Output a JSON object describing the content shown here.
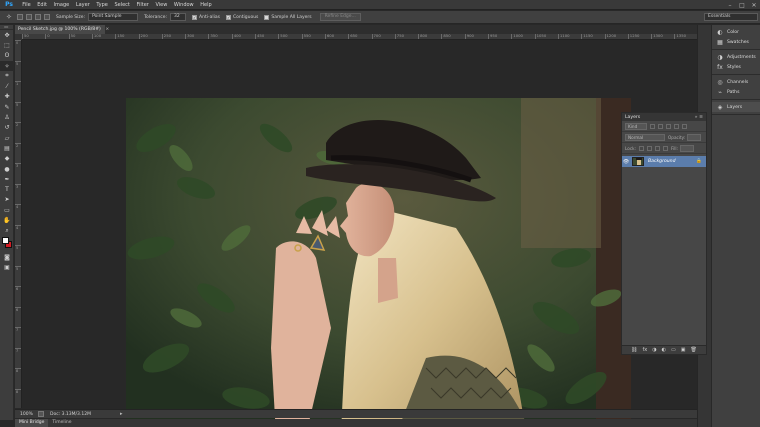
{
  "app": {
    "logo": "Ps"
  },
  "menu": [
    "File",
    "Edit",
    "Image",
    "Layer",
    "Type",
    "Select",
    "Filter",
    "View",
    "Window",
    "Help"
  ],
  "window_controls": [
    "–",
    "□",
    "✕"
  ],
  "options": {
    "tool_icon": "magic-wand-icon",
    "sample_size_label": "Sample Size:",
    "sample_size_value": "Point Sample",
    "tolerance_label": "Tolerance:",
    "tolerance_value": "32",
    "anti_alias": "Anti-alias",
    "contiguous": "Contiguous",
    "sample_all_layers": "Sample All Layers",
    "refine_edge": "Refine Edge...",
    "workspace": "Essentials"
  },
  "document": {
    "tab_title": "Pencil Sketch.jpg @ 100% (RGB/8#)",
    "close_glyph": "×"
  },
  "ruler_h": [
    "50",
    "0",
    "50",
    "100",
    "150",
    "200",
    "250",
    "300",
    "350",
    "400",
    "450",
    "500",
    "550",
    "600",
    "650",
    "700",
    "750",
    "800",
    "850",
    "900",
    "950",
    "1000",
    "1050",
    "1100",
    "1150",
    "1200",
    "1250",
    "1300",
    "1350",
    "1400"
  ],
  "ruler_v": [
    "0",
    "5",
    "1",
    "5",
    "2",
    "2",
    "3",
    "3",
    "4",
    "4",
    "5",
    "5",
    "6",
    "6",
    "7",
    "7",
    "8",
    "8"
  ],
  "toolbar": {
    "tools": [
      {
        "name": "move-tool-icon",
        "glyph": "✥"
      },
      {
        "name": "marquee-tool-icon",
        "glyph": "⬚"
      },
      {
        "name": "lasso-tool-icon",
        "glyph": "ʘ"
      },
      {
        "name": "magic-wand-tool-icon",
        "glyph": "✧"
      },
      {
        "name": "crop-tool-icon",
        "glyph": "⌗"
      },
      {
        "name": "eyedropper-tool-icon",
        "glyph": "⁄"
      },
      {
        "name": "healing-brush-tool-icon",
        "glyph": "✚"
      },
      {
        "name": "brush-tool-icon",
        "glyph": "✎"
      },
      {
        "name": "clone-stamp-tool-icon",
        "glyph": "♙"
      },
      {
        "name": "history-brush-tool-icon",
        "glyph": "↺"
      },
      {
        "name": "eraser-tool-icon",
        "glyph": "▱"
      },
      {
        "name": "gradient-tool-icon",
        "glyph": "▤"
      },
      {
        "name": "blur-tool-icon",
        "glyph": "◆"
      },
      {
        "name": "dodge-tool-icon",
        "glyph": "●"
      },
      {
        "name": "pen-tool-icon",
        "glyph": "✒"
      },
      {
        "name": "type-tool-icon",
        "glyph": "T"
      },
      {
        "name": "path-selection-tool-icon",
        "glyph": "➤"
      },
      {
        "name": "shape-tool-icon",
        "glyph": "▭"
      },
      {
        "name": "hand-tool-icon",
        "glyph": "✋"
      },
      {
        "name": "zoom-tool-icon",
        "glyph": "⌕"
      }
    ],
    "extra_tools": [
      {
        "name": "quick-mask-icon",
        "glyph": "◙"
      },
      {
        "name": "screen-mode-icon",
        "glyph": "▣"
      }
    ]
  },
  "status": {
    "zoom": "100%",
    "doc": "Doc: 3.13M/3.12M",
    "arrow": "▸"
  },
  "bottom_tabs": [
    "Mini Bridge",
    "Timeline"
  ],
  "panel_column": {
    "groups": [
      [
        {
          "icon": "color-icon",
          "glyph": "◐",
          "label": "Color"
        },
        {
          "icon": "swatches-icon",
          "glyph": "▦",
          "label": "Swatches"
        }
      ],
      [
        {
          "icon": "adjustments-icon",
          "glyph": "◑",
          "label": "Adjustments"
        },
        {
          "icon": "styles-icon",
          "glyph": "fx",
          "label": "Styles"
        }
      ],
      [
        {
          "icon": "channels-icon",
          "glyph": "◎",
          "label": "Channels"
        },
        {
          "icon": "paths-icon",
          "glyph": "⌁",
          "label": "Paths"
        }
      ],
      [
        {
          "icon": "layers-icon",
          "glyph": "◈",
          "label": "Layers"
        }
      ]
    ]
  },
  "layers_panel": {
    "title": "Layers",
    "menu_glyph": "≡",
    "collapse_glyph": "»",
    "filter_label": "Kind",
    "blend_mode": "Normal",
    "opacity_label": "Opacity:",
    "lock_label": "Lock:",
    "fill_label": "Fill:",
    "layer": {
      "name": "Background",
      "eye": "👁",
      "lock": "🔒"
    },
    "footer_buttons": [
      "⛓",
      "fx",
      "◑",
      "◐",
      "▭",
      "▣",
      "🗑"
    ]
  }
}
